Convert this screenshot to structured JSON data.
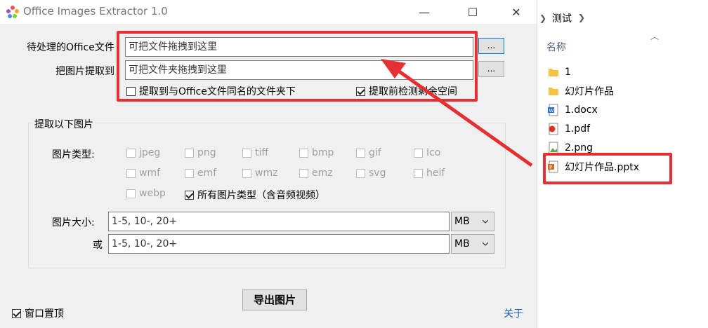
{
  "window": {
    "title": "Office Images Extractor 1.0",
    "minimize": "—",
    "maximize": "☐",
    "close": "✕"
  },
  "source": {
    "label": "待处理的Office文件",
    "placeholder": "可把文件拖拽到这里",
    "browse": "..."
  },
  "target": {
    "label": "把图片提取到",
    "placeholder": "可把文件夹拖拽到这里",
    "browse": "..."
  },
  "options": {
    "same_name_folder": {
      "label": "提取到与Office文件同名的文件夹下",
      "checked": false
    },
    "check_space": {
      "label": "提取前检测剩余空间",
      "checked": true
    }
  },
  "group": {
    "title": "提取以下图片",
    "types_label": "图片类型:",
    "types": [
      {
        "label": "jpeg",
        "checked": false,
        "enabled": false
      },
      {
        "label": "png",
        "checked": false,
        "enabled": false
      },
      {
        "label": "tiff",
        "checked": false,
        "enabled": false
      },
      {
        "label": "bmp",
        "checked": false,
        "enabled": false
      },
      {
        "label": "gif",
        "checked": false,
        "enabled": false
      },
      {
        "label": "Ico",
        "checked": false,
        "enabled": false
      },
      {
        "label": "wmf",
        "checked": false,
        "enabled": false
      },
      {
        "label": "emf",
        "checked": false,
        "enabled": false
      },
      {
        "label": "wmz",
        "checked": false,
        "enabled": false
      },
      {
        "label": "emz",
        "checked": false,
        "enabled": false
      },
      {
        "label": "svg",
        "checked": false,
        "enabled": false
      },
      {
        "label": "heif",
        "checked": false,
        "enabled": false
      },
      {
        "label": "webp",
        "checked": false,
        "enabled": false
      }
    ],
    "all_types": {
      "label": "所有图片类型（含音频视频）",
      "checked": true
    },
    "size_label": "图片大小:",
    "size1": {
      "placeholder": "1-5, 10-, 20+",
      "unit": "MB"
    },
    "or_label": "或",
    "size2": {
      "placeholder": "1-5, 10-, 20+",
      "unit": "MB"
    }
  },
  "export_button": "导出图片",
  "topmost": {
    "label": "窗口置顶",
    "checked": true
  },
  "about_link": "关于",
  "explorer": {
    "breadcrumb": "测试",
    "header": "名称",
    "files": [
      {
        "name": "1",
        "icon": "folder-icon"
      },
      {
        "name": "幻灯片作品",
        "icon": "folder-icon"
      },
      {
        "name": "1.docx",
        "icon": "word-icon"
      },
      {
        "name": "1.pdf",
        "icon": "pdf-icon"
      },
      {
        "name": "2.png",
        "icon": "image-icon"
      },
      {
        "name": "幻灯片作品.pptx",
        "icon": "powerpoint-icon"
      }
    ]
  },
  "colors": {
    "highlight": "#e53033",
    "accent": "#1a5fb4",
    "disabled_text": "#a0a0a0"
  }
}
